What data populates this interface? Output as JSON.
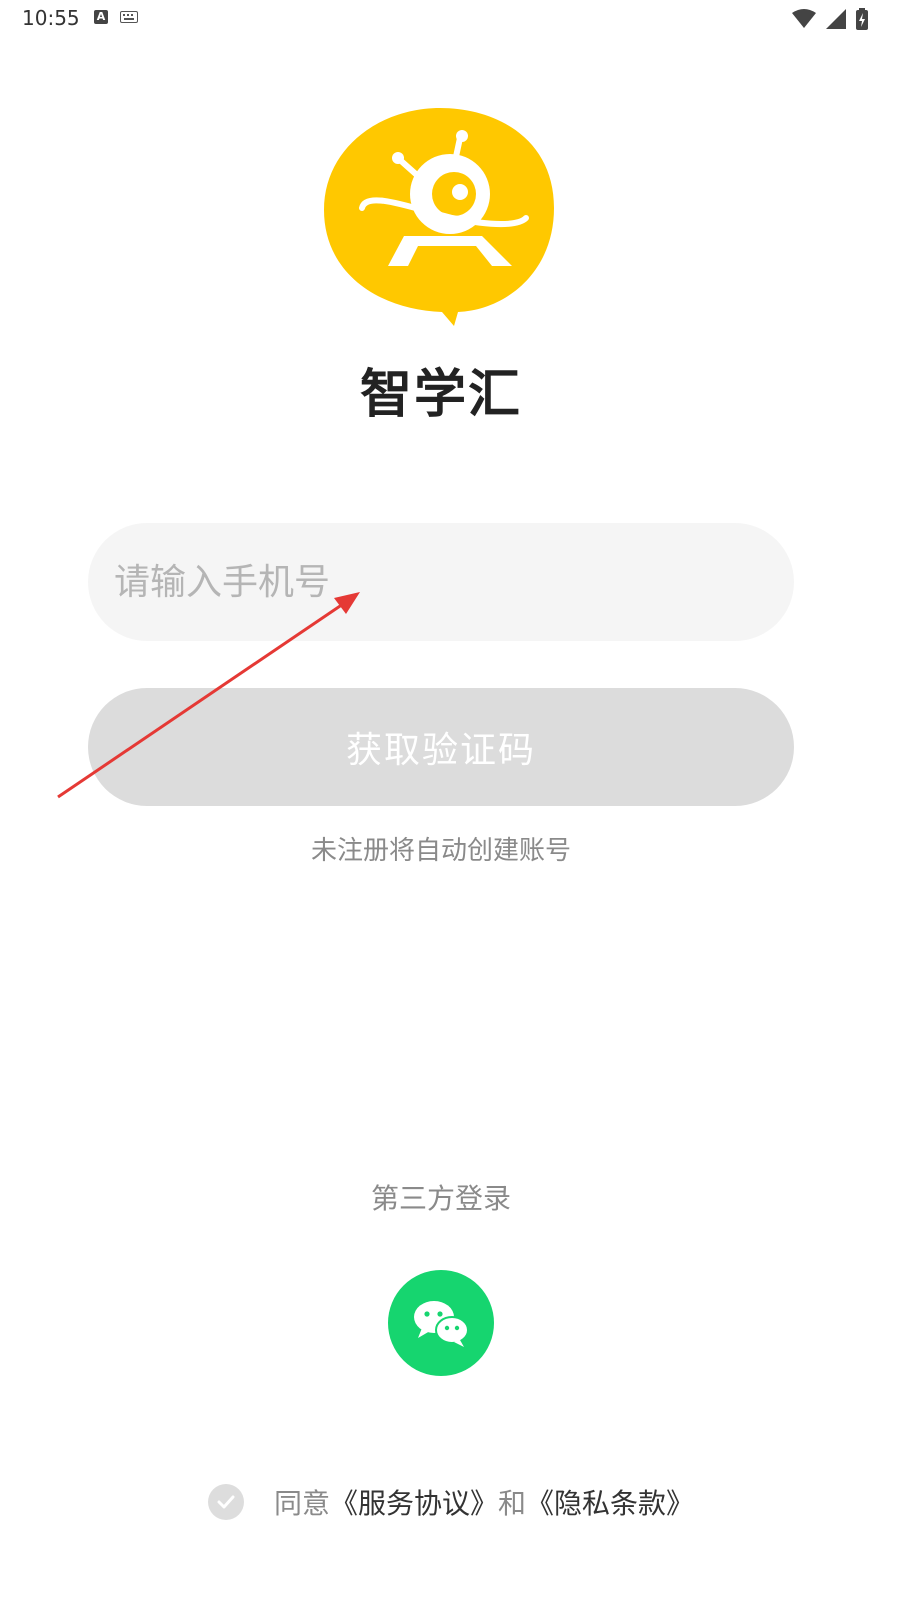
{
  "status_bar": {
    "time": "10:55",
    "icons": [
      "a-notification-icon",
      "keyboard-icon",
      "wifi-icon",
      "signal-icon",
      "battery-icon"
    ]
  },
  "app": {
    "name": "智学汇",
    "logo_icon": "robot-logo-icon",
    "brand_color": "#FFC800"
  },
  "login": {
    "phone_placeholder": "请输入手机号",
    "phone_value": "",
    "get_code_label": "获取验证码",
    "auto_register_hint": "未注册将自动创建账号"
  },
  "third_party": {
    "label": "第三方登录",
    "wechat_icon": "wechat-icon",
    "wechat_color": "#16D56F"
  },
  "agreement": {
    "agree_prefix": "同意",
    "service_link": "《服务协议》",
    "and": "和",
    "privacy_link": "《隐私条款》",
    "checked": false
  },
  "annotation": {
    "arrow_color": "#E53935"
  }
}
